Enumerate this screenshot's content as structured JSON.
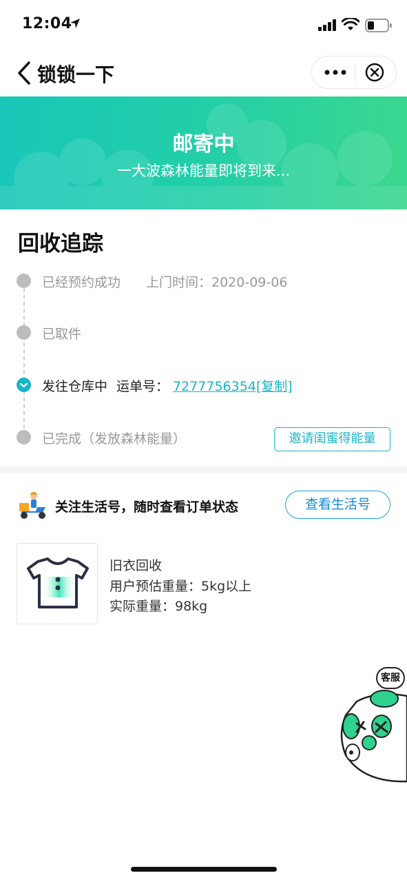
{
  "status_bar": {
    "time": "12:04"
  },
  "nav": {
    "title": "锁锁一下"
  },
  "banner": {
    "title": "邮寄中",
    "subtitle": "一大波森林能量即将到来..."
  },
  "tracking": {
    "title": "回收追踪",
    "steps": [
      {
        "label": "已经预约成功",
        "time": "上门时间：2020-09-06",
        "state": "done"
      },
      {
        "label": "已取件",
        "state": "done"
      },
      {
        "label": "发往仓库中",
        "waybill_label": "运单号：",
        "waybill": "7277756354[复制]",
        "state": "current"
      },
      {
        "label": "已完成（发放森林能量）",
        "state": "pending"
      }
    ],
    "invite_button": "邀请闺蜜得能量"
  },
  "follow": {
    "text": "关注生活号，随时查看订单状态",
    "button": "查看生活号"
  },
  "item": {
    "name": "旧衣回收",
    "estimated_weight": "用户预估重量：5kg以上",
    "actual_weight": "实际重量：98kg"
  },
  "customer_service": {
    "label": "客服"
  },
  "colors": {
    "accent": "#17b6c6",
    "banner_start": "#19c7b9",
    "banner_end": "#3ad78f",
    "link_blue": "#1689d8"
  },
  "icons": [
    "back-icon",
    "more-icon",
    "close-circle-icon",
    "check-icon",
    "courier-icon",
    "shirt-icon",
    "panda-icon"
  ]
}
